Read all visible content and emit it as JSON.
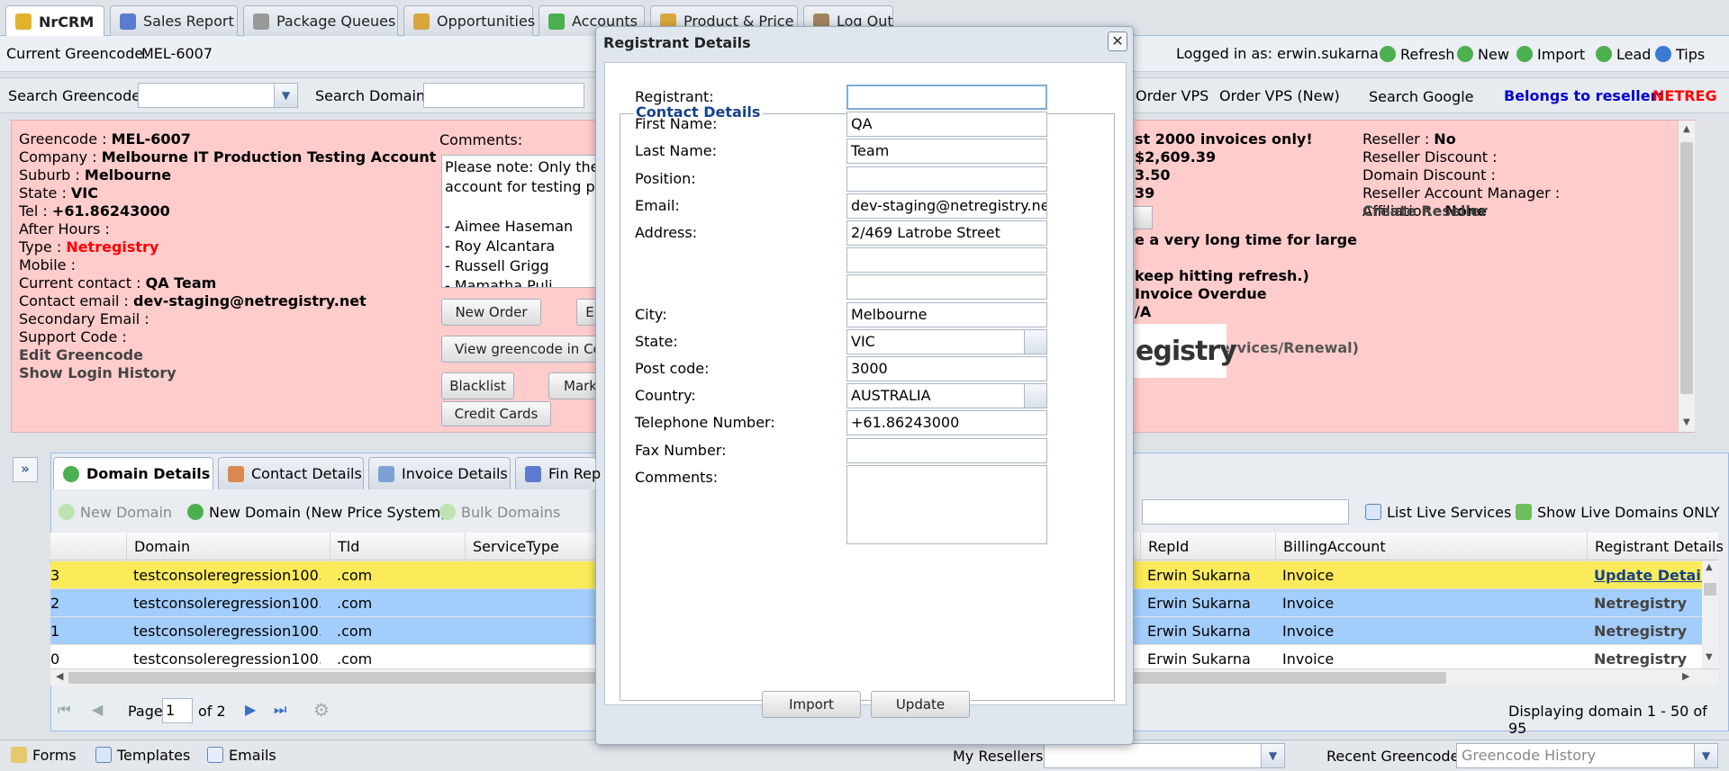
{
  "app_tabs": [
    {
      "label": "NrCRM",
      "icon": "user-group-icon",
      "active": true
    },
    {
      "label": "Sales Report",
      "icon": "bar-chart-icon"
    },
    {
      "label": "Package Queues",
      "icon": "gear-icon"
    },
    {
      "label": "Opportunities",
      "icon": "hand-coins-icon"
    },
    {
      "label": "Accounts",
      "icon": "dollar-icon"
    },
    {
      "label": "Product & Price",
      "icon": "package-icon"
    },
    {
      "label": "Log Out",
      "icon": "logout-icon"
    }
  ],
  "greencode_bar": {
    "current_label": "Current Greencode:",
    "current_value": "MEL-6007",
    "logged_in": "Logged in as: erwin.sukarna",
    "actions": [
      "Refresh",
      "New",
      "Import",
      "Lead",
      "Tips"
    ]
  },
  "search_bar": {
    "greencode_label": "Search Greencode:",
    "domain_label": "Search Domain:",
    "order_vps": "Order VPS",
    "order_vps_new": "Order VPS (New)",
    "search_google": "Search Google",
    "reseller_label": "Belongs to reseller:",
    "reseller_value": "NETREG"
  },
  "info": {
    "fields": [
      {
        "label": "Greencode : ",
        "value": "MEL-6007"
      },
      {
        "label": "Company : ",
        "value": "Melbourne IT Production Testing Account"
      },
      {
        "label": "Suburb : ",
        "value": "Melbourne"
      },
      {
        "label": "State : ",
        "value": "VIC"
      },
      {
        "label": "Tel : ",
        "value": "+61.86243000"
      },
      {
        "label": "After Hours :",
        "value": ""
      },
      {
        "label": "Type : ",
        "value": "Netregistry"
      },
      {
        "label": "Mobile :",
        "value": ""
      },
      {
        "label": "Current contact : ",
        "value": "QA Team"
      },
      {
        "label": "Contact email : ",
        "value": "dev-staging@netregistry.net"
      },
      {
        "label": "Secondary Email :",
        "value": ""
      },
      {
        "label": "Support Code :",
        "value": ""
      }
    ],
    "edit_greencode": "Edit Greencode",
    "show_login_history": "Show Login History",
    "comments_label": "Comments:",
    "comments_lines": [
      "Please note: Only the",
      "account for testing pu",
      "",
      "- Aimee Haseman",
      "- Roy Alcantara",
      "- Russell Grigg",
      "- Mamatha Puli"
    ],
    "buttons": {
      "new_order": "New Order",
      "e": "E",
      "view_greencode": "View greencode in Co",
      "blacklist": "Blacklist",
      "mark": "Mark",
      "credit_cards": "Credit Cards"
    },
    "mid_lines": [
      "st 2000 invoices only!",
      "$2,609.39",
      "3.50",
      "39",
      "e a very long time for large",
      "keep hitting refresh.)",
      " Invoice Overdue",
      "/A",
      "s",
      "ice (New Services/Renewal)"
    ],
    "logo_fragment": "egistry",
    "reseller": [
      {
        "label": "Reseller : ",
        "value": "No"
      },
      {
        "label": "Reseller Discount :",
        "value": ""
      },
      {
        "label": "Domain Discount :",
        "value": ""
      },
      {
        "label": "Reseller Account Manager :",
        "value": ""
      },
      {
        "label": "Affiliation : ",
        "value": "None"
      }
    ],
    "create_reseller": "Create Reseller"
  },
  "lower_tabs": [
    {
      "label": "Domain Details",
      "active": true
    },
    {
      "label": "Contact Details"
    },
    {
      "label": "Invoice Details"
    },
    {
      "label": "Fin Rep"
    }
  ],
  "lower_toolbar": {
    "new_domain": "New Domain",
    "new_domain_new": "New Domain (New Price System)",
    "bulk_domains": "Bulk Domains",
    "filter_suffix": ":",
    "list_live": "List Live Services",
    "show_live": "Show Live Domains ONLY"
  },
  "grid": {
    "headers": [
      "Domain",
      "Tld",
      "ServiceType",
      "RepId",
      "BillingAccount",
      "Registrant Details"
    ],
    "rows": [
      {
        "num": "3",
        "domain": "testconsoleregression100…",
        "tld": ".com",
        "rep": "Erwin Sukarna",
        "billing": "Invoice",
        "registrant": "Update Details",
        "style": "yellow"
      },
      {
        "num": "2",
        "domain": "testconsoleregression100…",
        "tld": ".com",
        "rep": "Erwin Sukarna",
        "billing": "Invoice",
        "registrant": "Netregistry",
        "style": "blue"
      },
      {
        "num": "1",
        "domain": "testconsoleregression100…",
        "tld": ".com",
        "rep": "Erwin Sukarna",
        "billing": "Invoice",
        "registrant": "Netregistry",
        "style": "blue"
      },
      {
        "num": "0",
        "domain": "testconsoleregression100…",
        "tld": ".com",
        "rep": "Erwin Sukarna",
        "billing": "Invoice",
        "registrant": "Netregistry",
        "style": "white"
      }
    ]
  },
  "pager": {
    "page_label": "Page",
    "page_value": "1",
    "of_label": "of 2",
    "displaying": "Displaying domain 1 - 50 of 95"
  },
  "statusbar": {
    "forms": "Forms",
    "templates": "Templates",
    "emails": "Emails",
    "my_resellers": "My Resellers:",
    "recent_greencode": "Recent Greencode:",
    "greencode_history_placeholder": "Greencode History"
  },
  "modal": {
    "title": "Registrant Details",
    "legend": "Contact Details",
    "fields": [
      {
        "label": "Registrant:",
        "value": "",
        "type": "text",
        "focused": true
      },
      {
        "label": "First Name:",
        "value": "QA",
        "type": "text"
      },
      {
        "label": "Last Name:",
        "value": "Team",
        "type": "text"
      },
      {
        "label": "Position:",
        "value": "",
        "type": "text"
      },
      {
        "label": "Email:",
        "value": "dev-staging@netregistry.ne",
        "type": "text"
      },
      {
        "label": "Address:",
        "value": "2/469 Latrobe Street",
        "type": "text"
      },
      {
        "label": "",
        "value": "",
        "type": "text"
      },
      {
        "label": "",
        "value": "",
        "type": "text"
      },
      {
        "label": "City:",
        "value": "Melbourne",
        "type": "text"
      },
      {
        "label": "State:",
        "value": "VIC",
        "type": "combo"
      },
      {
        "label": "Post code:",
        "value": "3000",
        "type": "text"
      },
      {
        "label": "Country:",
        "value": "AUSTRALIA",
        "type": "combo"
      },
      {
        "label": "Telephone Number:",
        "value": "+61.86243000",
        "type": "text"
      },
      {
        "label": "Fax Number:",
        "value": "",
        "type": "text"
      },
      {
        "label": "Comments:",
        "value": "",
        "type": "textarea"
      }
    ],
    "import_label": "Import",
    "update_label": "Update"
  },
  "colors": {
    "info_bg": "#ffcccc",
    "row_yellow": "#fbea5a",
    "row_blue": "#a3cdfb",
    "reseller_red": "#ff0000",
    "reseller_blue": "#0000cc"
  }
}
